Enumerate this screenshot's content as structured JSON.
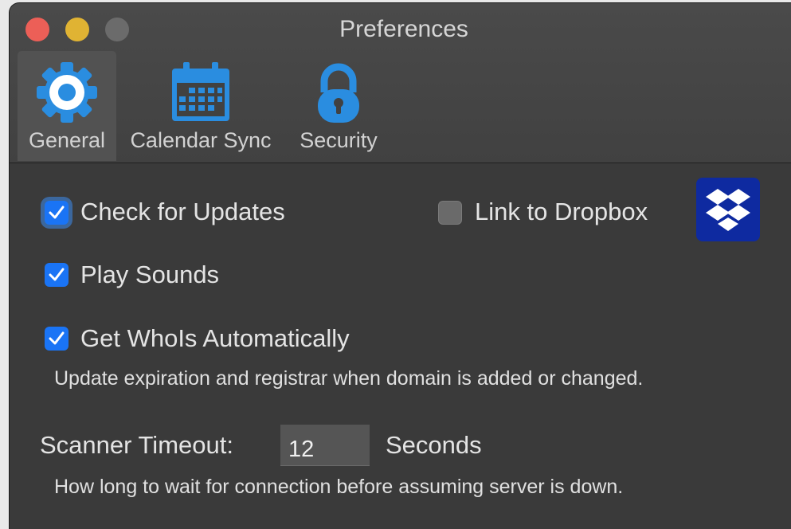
{
  "window": {
    "title": "Preferences"
  },
  "tabs": [
    {
      "label": "General",
      "icon": "gear-icon",
      "active": true
    },
    {
      "label": "Calendar Sync",
      "icon": "calendar-icon",
      "active": false
    },
    {
      "label": "Security",
      "icon": "lock-icon",
      "active": false
    }
  ],
  "general": {
    "check_updates": {
      "label": "Check for Updates",
      "checked": true
    },
    "link_dropbox": {
      "label": "Link to Dropbox",
      "checked": false
    },
    "play_sounds": {
      "label": "Play Sounds",
      "checked": true
    },
    "get_whois": {
      "label": "Get WhoIs Automatically",
      "checked": true
    },
    "whois_desc": "Update expiration and registrar when domain is added or changed.",
    "scanner_timeout": {
      "label": "Scanner Timeout:",
      "value": "12",
      "unit": "Seconds",
      "desc": "How long to wait for connection before assuming server is down."
    }
  },
  "colors": {
    "accent": "#1a74f5",
    "icon_blue": "#2a8de0",
    "dropbox_blue": "#0e2aa0",
    "background": "#3a3a3a",
    "close": "#ec5f57",
    "minimize": "#e0b333",
    "zoom_inactive": "#6b6b6b"
  }
}
